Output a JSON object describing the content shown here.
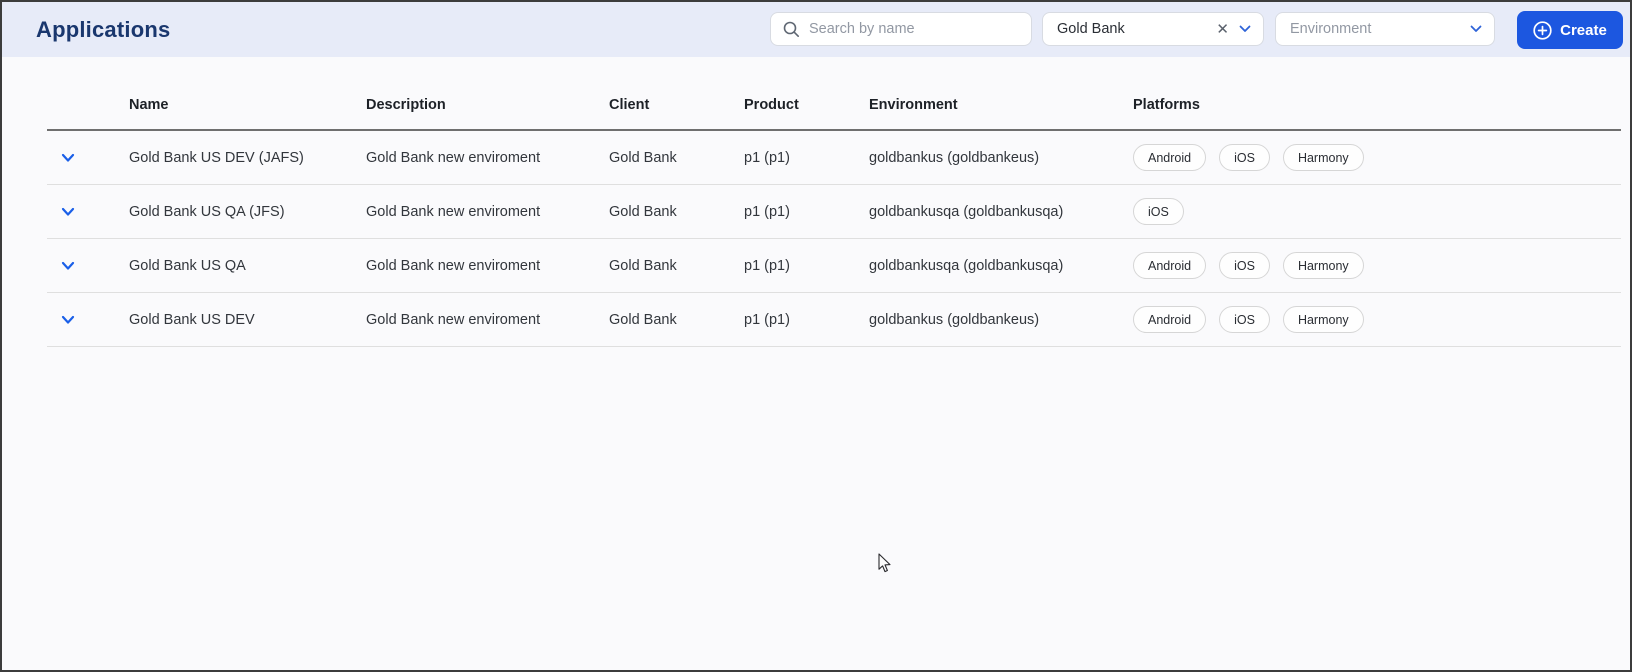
{
  "page": {
    "title": "Applications"
  },
  "toolbar": {
    "search": {
      "placeholder": "Search by name"
    },
    "client_filter": {
      "value": "Gold Bank"
    },
    "environment_filter": {
      "placeholder": "Environment"
    },
    "create_label": "Create"
  },
  "table": {
    "columns": [
      "Name",
      "Description",
      "Client",
      "Product",
      "Environment",
      "Platforms"
    ],
    "rows": [
      {
        "name": "Gold Bank US DEV (JAFS)",
        "description": "Gold Bank new enviroment",
        "client": "Gold Bank",
        "product": "p1 (p1)",
        "environment": "goldbankus (goldbankeus)",
        "platforms": [
          "Android",
          "iOS",
          "Harmony"
        ]
      },
      {
        "name": "Gold Bank US QA (JFS)",
        "description": "Gold Bank new enviroment",
        "client": "Gold Bank",
        "product": "p1 (p1)",
        "environment": "goldbankusqa (goldbankusqa)",
        "platforms": [
          "iOS"
        ]
      },
      {
        "name": "Gold Bank US QA",
        "description": "Gold Bank new enviroment",
        "client": "Gold Bank",
        "product": "p1 (p1)",
        "environment": "goldbankusqa (goldbankusqa)",
        "platforms": [
          "Android",
          "iOS",
          "Harmony"
        ]
      },
      {
        "name": "Gold Bank US DEV",
        "description": "Gold Bank new enviroment",
        "client": "Gold Bank",
        "product": "p1 (p1)",
        "environment": "goldbankus (goldbankeus)",
        "platforms": [
          "Android",
          "iOS",
          "Harmony"
        ]
      }
    ]
  },
  "colors": {
    "topbar_bg": "#E7EBF8",
    "title_text": "#1A376E",
    "accent_blue": "#1C57E0",
    "chevron_blue": "#2E63D8",
    "row_separator": "#DFDFDF",
    "header_underline": "#6F6F6F"
  }
}
